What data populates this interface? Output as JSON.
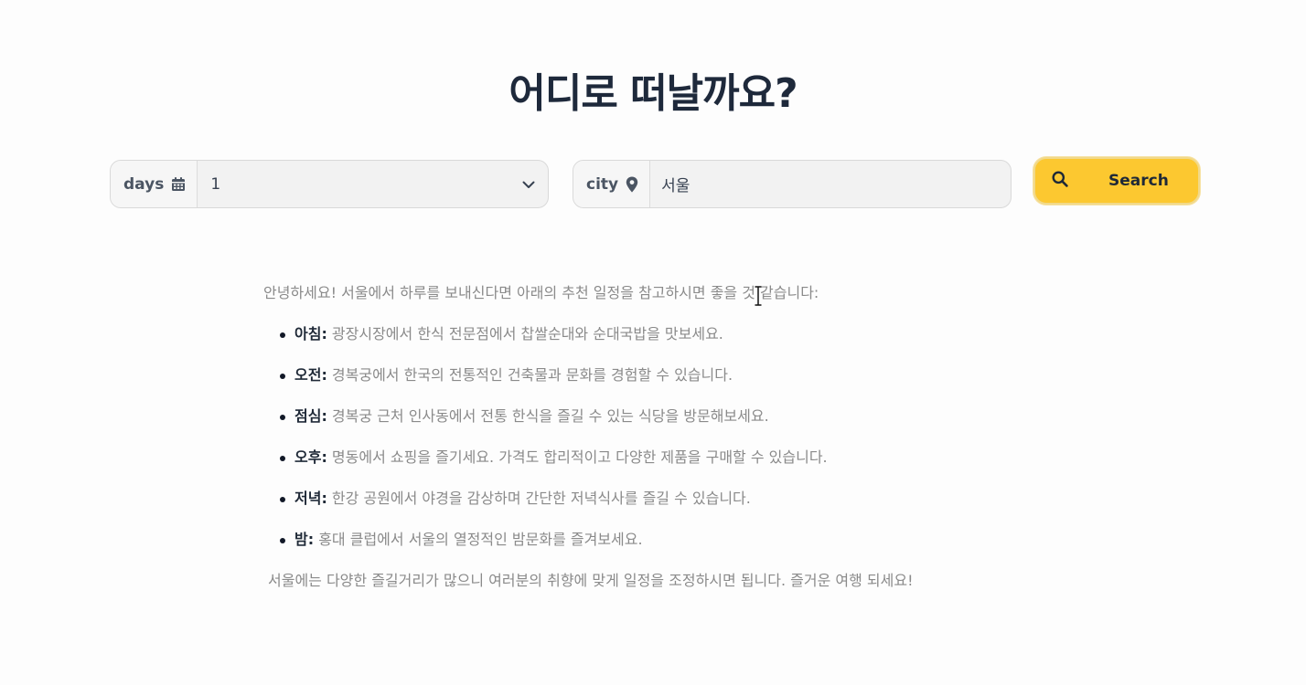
{
  "title": "어디로 떠날까요?",
  "days_field": {
    "prefix_label": "days",
    "icon": "calendar-icon",
    "selected_value": "1",
    "dropdown_icon": "chevron-down-icon"
  },
  "city_field": {
    "prefix_label": "city",
    "icon": "map-pin-icon",
    "value": "서울"
  },
  "search_button": {
    "label": "Search",
    "icon": "search-icon",
    "color": "#fcc830"
  },
  "result": {
    "intro": "안녕하세요! 서울에서 하루를 보내신다면 아래의 추천 일정을 참고하시면 좋을 것 같습니다:",
    "items": [
      {
        "label": "아침:",
        "text": " 광장시장에서 한식 전문점에서 찹쌀순대와 순대국밥을 맛보세요."
      },
      {
        "label": "오전:",
        "text": " 경복궁에서 한국의 전통적인 건축물과 문화를 경험할 수 있습니다."
      },
      {
        "label": "점심:",
        "text": " 경복궁 근처 인사동에서 전통 한식을 즐길 수 있는 식당을 방문해보세요."
      },
      {
        "label": "오후:",
        "text": " 명동에서 쇼핑을 즐기세요. 가격도 합리적이고 다양한 제품을 구매할 수 있습니다."
      },
      {
        "label": "저녁:",
        "text": " 한강 공원에서 야경을 감상하며 간단한 저녁식사를 즐길 수 있습니다."
      },
      {
        "label": "밤:",
        "text": " 홍대 클럽에서 서울의 열정적인 밤문화를 즐겨보세요."
      }
    ],
    "outro": "서울에는 다양한 즐길거리가 많으니 여러분의 취향에 맞게 일정을 조정하시면 됩니다. 즐거운 여행 되세요!"
  }
}
